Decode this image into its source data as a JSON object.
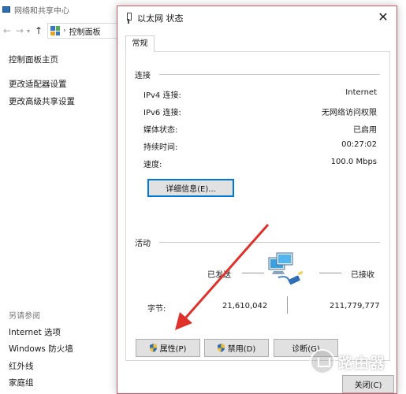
{
  "background_window": {
    "title": "网络和共享中心",
    "address": {
      "crumb": "控制面板"
    },
    "sidebar": {
      "top_links": [
        "控制面板主页",
        "更改适配器设置",
        "更改高级共享设置"
      ],
      "see_also_heading": "另请参阅",
      "see_also_links": [
        "Internet 选项",
        "Windows 防火墙",
        "红外线",
        "家庭组"
      ]
    }
  },
  "dialog": {
    "title": "以太网 状态",
    "close_glyph": "✕",
    "tab_label": "常规",
    "connection": {
      "heading": "连接",
      "rows": [
        {
          "label": "IPv4 连接:",
          "value": "Internet"
        },
        {
          "label": "IPv6 连接:",
          "value": "无网络访问权限"
        },
        {
          "label": "媒体状态:",
          "value": "已启用"
        },
        {
          "label": "持续时间:",
          "value": "00:27:02"
        },
        {
          "label": "速度:",
          "value": "100.0 Mbps"
        }
      ],
      "details_button": "详细信息(E)..."
    },
    "activity": {
      "heading": "活动",
      "sent_label": "已发送",
      "received_label": "已接收",
      "bytes_label": "字节:",
      "bytes_sent": "21,610,042",
      "bytes_received": "211,779,777"
    },
    "buttons": {
      "properties": "属性(P)",
      "disable": "禁用(D)",
      "diagnose": "诊断(G)",
      "close": "关闭(C)"
    }
  },
  "watermark": {
    "text": "路由器"
  },
  "colors": {
    "dialog_border": "#c55a6a",
    "annotation_arrow": "#e0302a",
    "focus_blue": "#0078d7"
  }
}
